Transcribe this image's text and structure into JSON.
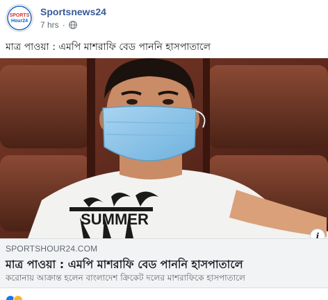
{
  "post": {
    "author": "Sportsnews24",
    "time": "7 hrs",
    "separator": "·",
    "text": "মাত্র পাওয়া : এমপি মাশরাফি বেড পাননি হাসপাতালে"
  },
  "avatar": {
    "logo_line1": "SPORTS",
    "logo_line2": "Hour24"
  },
  "photo": {
    "shirt_text": "SUMMER"
  },
  "link_preview": {
    "domain": "SPORTSHOUR24.COM",
    "title": "মাত্র পাওয়া : এমপি মাশরাফি বেড পাননি হাসপাতালে",
    "description": "করোনায় আক্রান্ত হলেন বাংলাদেশ ক্রিকেট দলের মাশরাফিকে হাসপাতালে"
  },
  "icons": {
    "info": "i",
    "privacy": "globe-icon"
  },
  "colors": {
    "author": "#385898",
    "meta": "#606770",
    "preview_bg": "#f2f3f5",
    "logo_red": "#d32f2f",
    "logo_blue": "#1565c0"
  }
}
